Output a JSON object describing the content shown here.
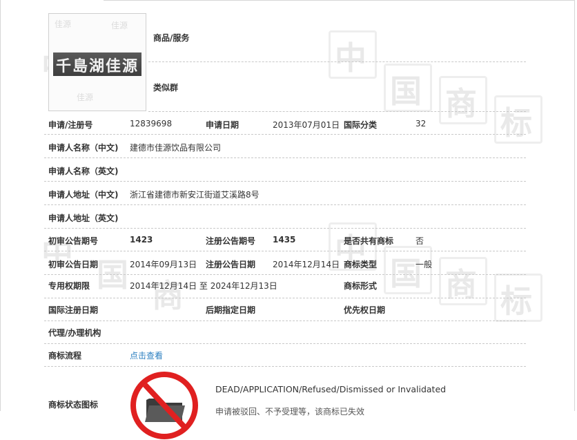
{
  "watermark": {
    "chars": [
      "中",
      "国",
      "商",
      "标"
    ]
  },
  "logo": {
    "text": "千島湖佳源",
    "noise_text": "佳源"
  },
  "goods_label": "商品/服务",
  "similar_group_label": "类似群",
  "rows": {
    "reg_no": {
      "label": "申请/注册号",
      "value": "12839698",
      "date_label": "申请日期",
      "date_value": "2013年07月01日",
      "class_label": "国际分类",
      "class_value": "32"
    },
    "applicant_cn": {
      "label": "申请人名称（中文)",
      "value": "建德市佳源饮品有限公司"
    },
    "applicant_en": {
      "label": "申请人名称（英文)",
      "value": ""
    },
    "address_cn": {
      "label": "申请人地址（中文)",
      "value": "浙江省建德市新安江街道艾溪路8号"
    },
    "address_en": {
      "label": "申请人地址（英文)",
      "value": ""
    },
    "prelim_no": {
      "label": "初审公告期号",
      "value": "1423",
      "reg_label": "注册公告期号",
      "reg_value": "1435",
      "shared_label": "是否共有商标",
      "shared_value": "否"
    },
    "prelim_date": {
      "label": "初审公告日期",
      "value": "2014年09月13日",
      "reg_label": "注册公告日期",
      "reg_value": "2014年12月14日",
      "type_label": "商标类型",
      "type_value": "一般"
    },
    "exclusive": {
      "label": "专用权期限",
      "value": "2014年12月14日 至 2024年12月13日",
      "form_label": "商标形式",
      "form_value": ""
    },
    "intl": {
      "label": "国际注册日期",
      "value": "",
      "later_label": "后期指定日期",
      "later_value": "",
      "priority_label": "优先权日期",
      "priority_value": ""
    },
    "agent": {
      "label": "代理/办理机构",
      "value": ""
    },
    "flow": {
      "label": "商标流程",
      "link": "点击查看"
    },
    "status": {
      "label": "商标状态图标",
      "en": "DEAD/APPLICATION/Refused/Dismissed or Invalidated",
      "cn": "申请被驳回、不予受理等，该商标已失效"
    }
  },
  "colors": {
    "link": "#2b7fc0",
    "status_red": "#e02020",
    "dashed": "#c8c8c8"
  }
}
